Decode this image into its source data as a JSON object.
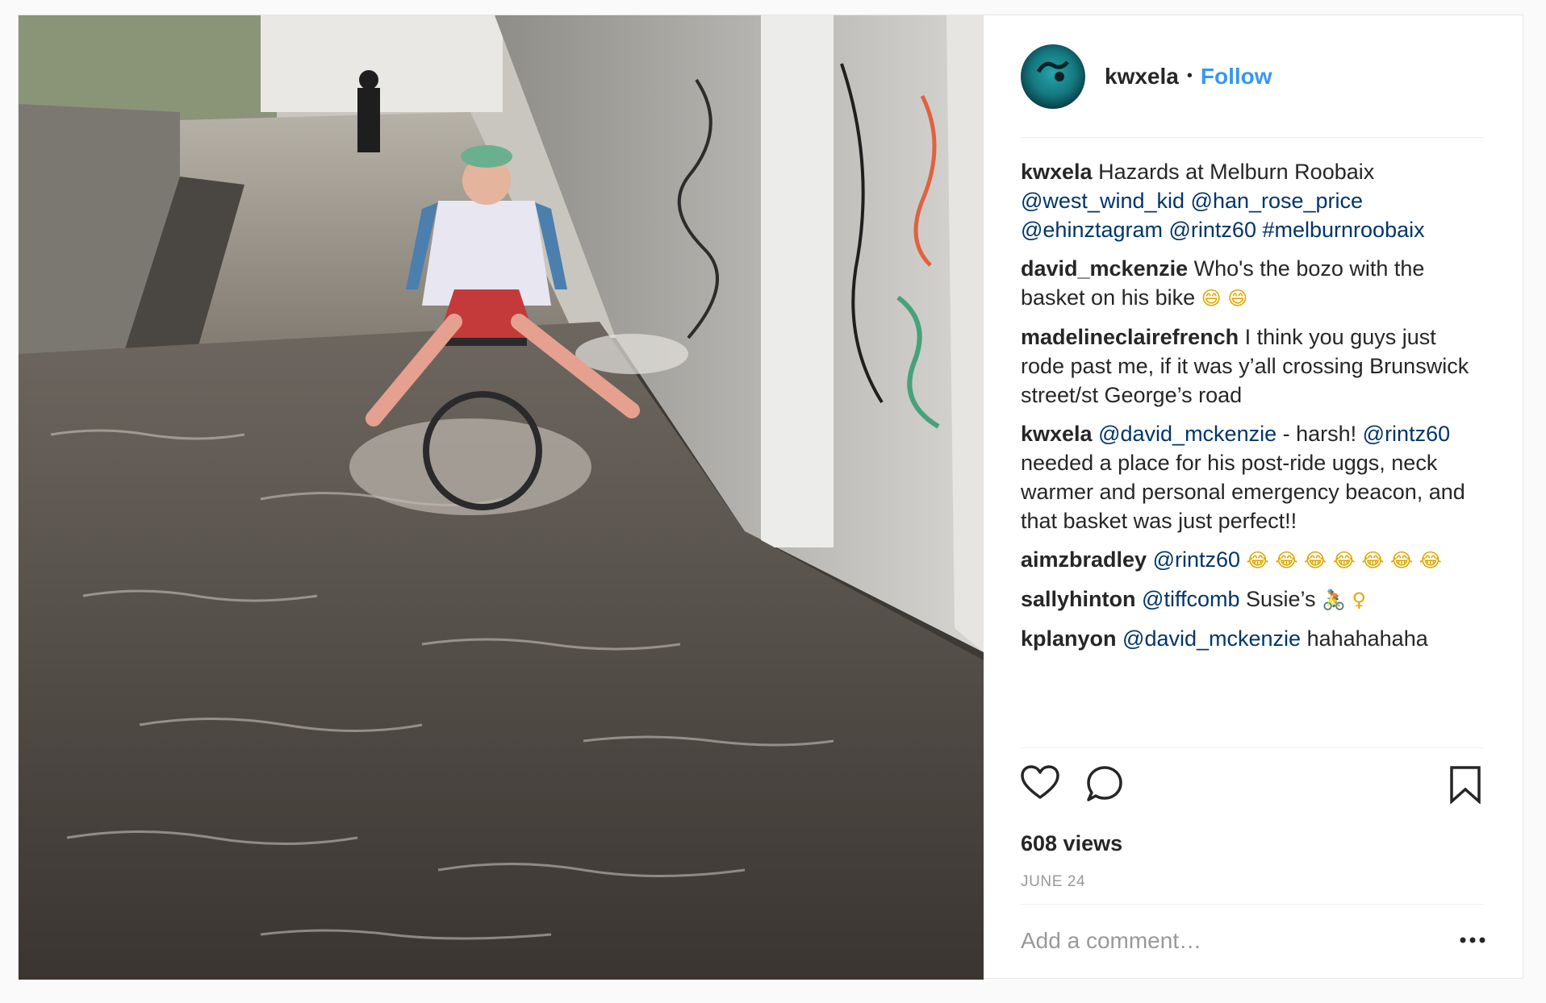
{
  "post": {
    "username": "kwxela",
    "separator": "•",
    "follow_label": "Follow",
    "caption": {
      "user": "kwxela",
      "text_1": " Hazards at Melburn Roobaix ",
      "mentions": [
        "@west_wind_kid",
        "@han_rose_price",
        "@ehinztagram",
        "@rintz60",
        "#melburnroobaix"
      ]
    },
    "comments": [
      {
        "user": "david_mckenzie",
        "text": " Who's the bozo with the basket on his bike ",
        "emoji": "😄 😄"
      },
      {
        "user": "madelineclairefrench",
        "text": " I think you guys just rode past me, if it was y’all crossing Brunswick street/st George’s road"
      },
      {
        "user": "kwxela",
        "mention_1": "@david_mckenzie",
        "text_1": " - harsh! ",
        "mention_2": "@rintz60",
        "text_2": " needed a place for his post-ride uggs, neck warmer and personal emergency beacon, and that basket was just perfect!!"
      },
      {
        "user": "aimzbradley",
        "mention": "@rintz60",
        "emoji": " 😂 😂 😂 😂 😂 😂 😂"
      },
      {
        "user": "sallyhinton",
        "mention": "@tiffcomb",
        "text": " Susie’s ",
        "emoji": "🚴 ♀"
      },
      {
        "user": "kplanyon",
        "mention": "@david_mckenzie",
        "text": " hahahahaha"
      }
    ],
    "views": "608 views",
    "date": "JUNE 24",
    "add_comment_placeholder": "Add a comment…",
    "icons": {
      "like": "heart-icon",
      "comment": "comment-bubble-icon",
      "save": "bookmark-icon",
      "more": "more-options-icon"
    },
    "colors": {
      "follow": "#3897f0",
      "mention": "#003569",
      "meta": "#999999"
    }
  }
}
